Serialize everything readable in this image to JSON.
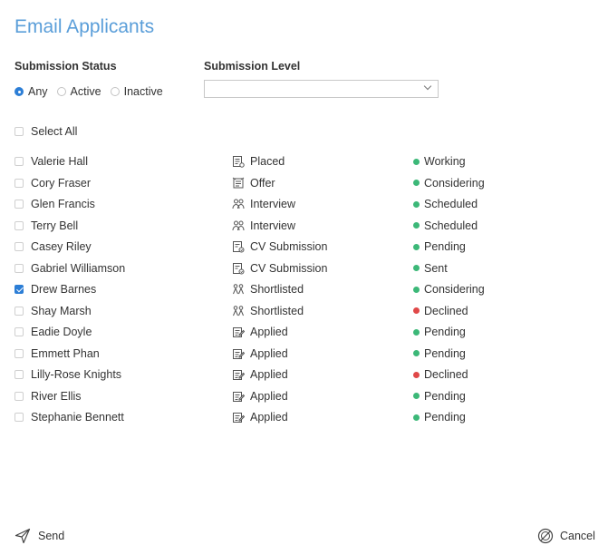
{
  "title": "Email Applicants",
  "filters": {
    "status_label": "Submission Status",
    "status_options": [
      {
        "label": "Any",
        "selected": true
      },
      {
        "label": "Active",
        "selected": false
      },
      {
        "label": "Inactive",
        "selected": false
      }
    ],
    "level_label": "Submission Level",
    "level_value": ""
  },
  "select_all_label": "Select All",
  "applicants": [
    {
      "name": "Valerie Hall",
      "checked": false,
      "stage": "Placed",
      "stage_icon": "placed-icon",
      "status": "Working",
      "status_color": "#3cb878"
    },
    {
      "name": "Cory Fraser",
      "checked": false,
      "stage": "Offer",
      "stage_icon": "offer-icon",
      "status": "Considering",
      "status_color": "#3cb878"
    },
    {
      "name": "Glen Francis",
      "checked": false,
      "stage": "Interview",
      "stage_icon": "interview-icon",
      "status": "Scheduled",
      "status_color": "#3cb878"
    },
    {
      "name": "Terry Bell",
      "checked": false,
      "stage": "Interview",
      "stage_icon": "interview-icon",
      "status": "Scheduled",
      "status_color": "#3cb878"
    },
    {
      "name": "Casey Riley",
      "checked": false,
      "stage": "CV Submission",
      "stage_icon": "cv-submission-icon",
      "status": "Pending",
      "status_color": "#3cb878"
    },
    {
      "name": "Gabriel Williamson",
      "checked": false,
      "stage": "CV Submission",
      "stage_icon": "cv-submission-icon",
      "status": "Sent",
      "status_color": "#3cb878"
    },
    {
      "name": "Drew Barnes",
      "checked": true,
      "stage": "Shortlisted",
      "stage_icon": "shortlisted-icon",
      "status": "Considering",
      "status_color": "#3cb878"
    },
    {
      "name": "Shay Marsh",
      "checked": false,
      "stage": "Shortlisted",
      "stage_icon": "shortlisted-icon",
      "status": "Declined",
      "status_color": "#e04848"
    },
    {
      "name": "Eadie Doyle",
      "checked": false,
      "stage": "Applied",
      "stage_icon": "applied-icon",
      "status": "Pending",
      "status_color": "#3cb878"
    },
    {
      "name": "Emmett Phan",
      "checked": false,
      "stage": "Applied",
      "stage_icon": "applied-icon",
      "status": "Pending",
      "status_color": "#3cb878"
    },
    {
      "name": "Lilly-Rose Knights",
      "checked": false,
      "stage": "Applied",
      "stage_icon": "applied-icon",
      "status": "Declined",
      "status_color": "#e04848"
    },
    {
      "name": "River Ellis",
      "checked": false,
      "stage": "Applied",
      "stage_icon": "applied-icon",
      "status": "Pending",
      "status_color": "#3cb878"
    },
    {
      "name": "Stephanie Bennett",
      "checked": false,
      "stage": "Applied",
      "stage_icon": "applied-icon",
      "status": "Pending",
      "status_color": "#3cb878"
    }
  ],
  "footer": {
    "send_label": "Send",
    "cancel_label": "Cancel"
  }
}
